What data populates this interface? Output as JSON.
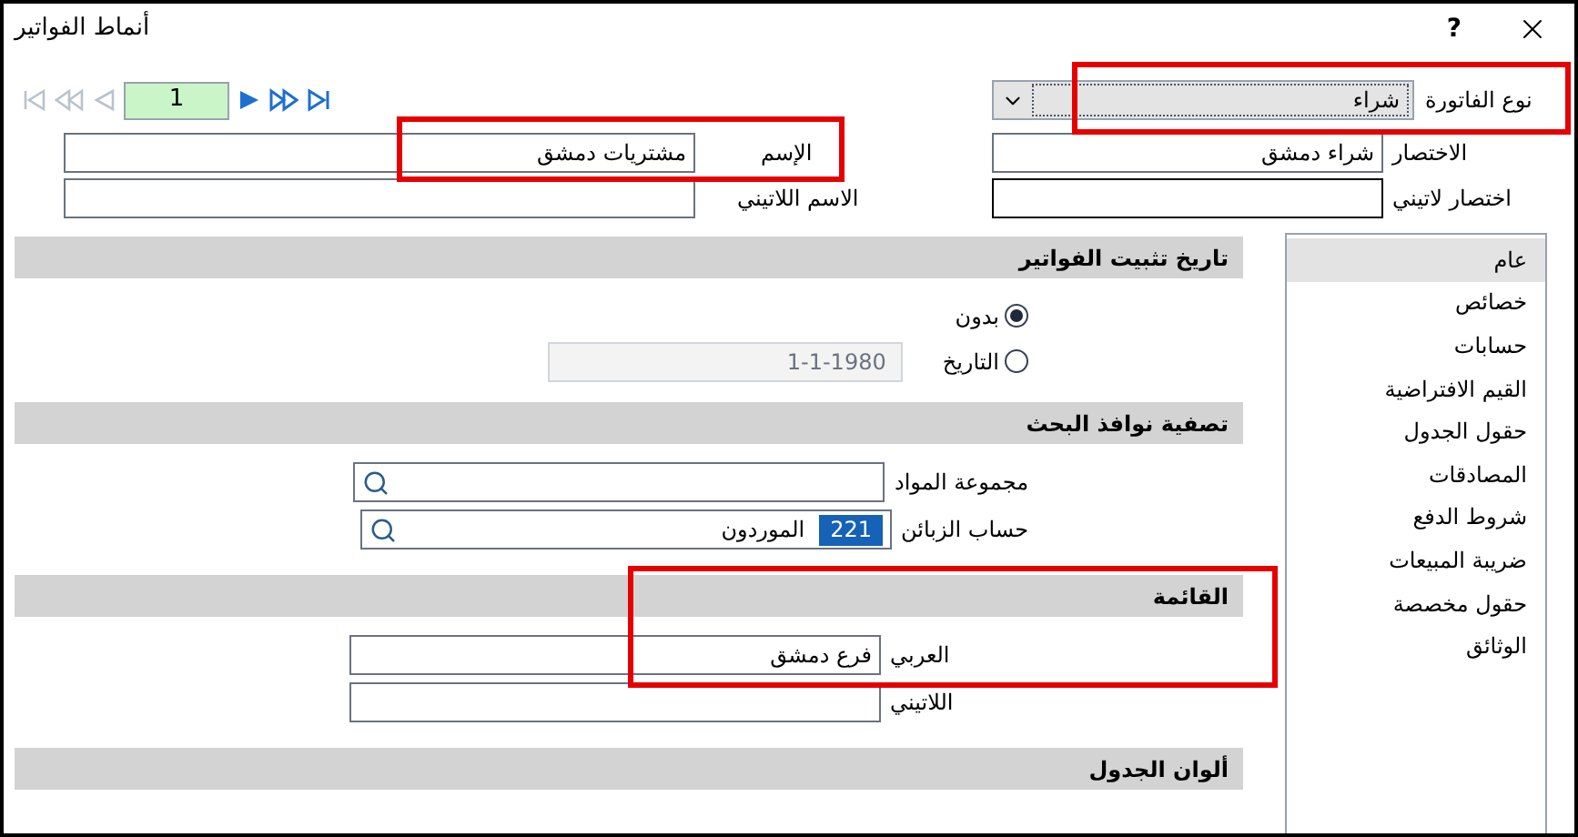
{
  "window": {
    "title": "أنماط الفواتير",
    "help": "?"
  },
  "record_nav": {
    "value": "1",
    "can_go_back": false,
    "can_go_forward": true
  },
  "header_fields": {
    "invoice_type": {
      "label": "نوع الفاتورة",
      "value": "شراء",
      "highlighted": true
    },
    "abbreviation": {
      "label": "الاختصار",
      "value": "شراء دمشق"
    },
    "latin_abbreviation": {
      "label": "اختصار لاتيني",
      "focused": true
    },
    "name": {
      "label": "الإسم",
      "value": "مشتريات دمشق",
      "highlighted": true
    },
    "latin_name": {
      "label": "الاسم اللاتيني"
    }
  },
  "sections": [
    {
      "kind": "radios",
      "title": "تاريخ تثبيت الفواتير",
      "highlighted": false,
      "options": [
        {
          "label": "بدون",
          "selected": true
        },
        {
          "label": "التاريخ",
          "selected": false,
          "date": "1-1-1980",
          "disabled": true
        }
      ]
    },
    {
      "kind": "lookups",
      "title": "تصفية نوافذ البحث",
      "highlighted": false,
      "fields": [
        {
          "label": "مجموعة المواد"
        },
        {
          "label": "حساب الزبائن",
          "code": "221",
          "value": "الموردون"
        }
      ]
    },
    {
      "kind": "texts",
      "title": "القائمة",
      "highlighted": true,
      "fields": [
        {
          "label": "العربي",
          "value": "فرع دمشق"
        },
        {
          "label": "اللاتيني"
        }
      ]
    },
    {
      "kind": "texts",
      "title": "ألوان الجدول",
      "highlighted": false
    }
  ],
  "sidebar": {
    "items": [
      {
        "label": "عام",
        "selected": true
      },
      {
        "label": "خصائص",
        "selected": false
      },
      {
        "label": "حسابات",
        "selected": false
      },
      {
        "label": "القيم الافتراضية",
        "selected": false
      },
      {
        "label": "حقول الجدول",
        "selected": false
      },
      {
        "label": "المصادقات",
        "selected": false
      },
      {
        "label": "شروط الدفع",
        "selected": false
      },
      {
        "label": "ضريبة المبيعات",
        "selected": false
      },
      {
        "label": "حقول مخصصة",
        "selected": false
      },
      {
        "label": "الوثائق",
        "selected": false
      }
    ]
  }
}
